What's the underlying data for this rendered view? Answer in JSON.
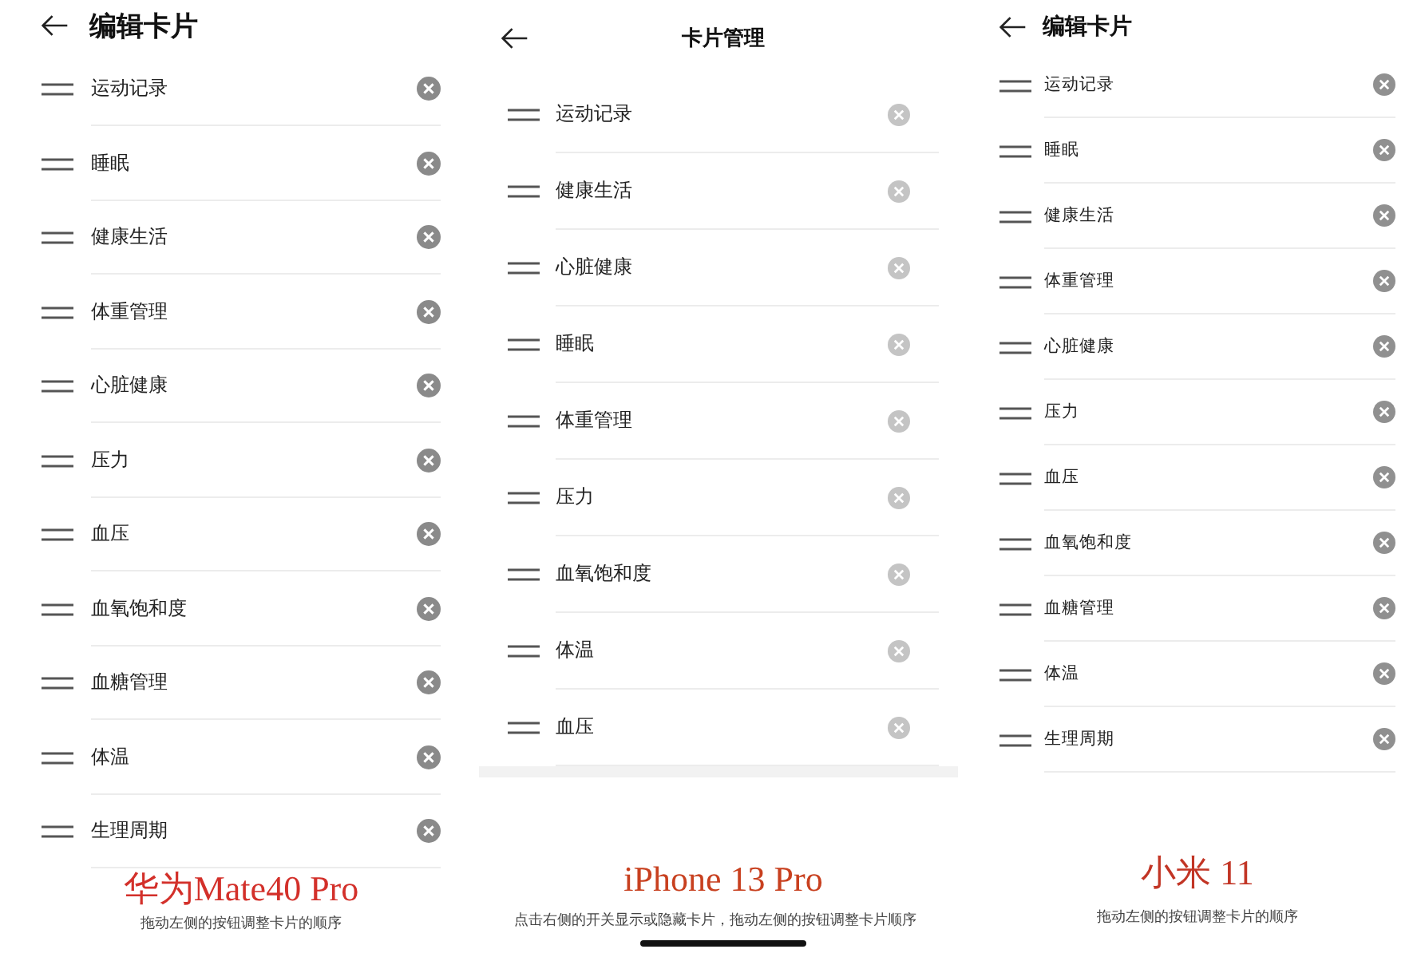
{
  "panels": [
    {
      "kind": "android",
      "title": "编辑卡片",
      "items": [
        {
          "label": "运动记录"
        },
        {
          "label": "睡眠"
        },
        {
          "label": "健康生活"
        },
        {
          "label": "体重管理"
        },
        {
          "label": "心脏健康"
        },
        {
          "label": "压力"
        },
        {
          "label": "血压"
        },
        {
          "label": "血氧饱和度"
        },
        {
          "label": "血糖管理"
        },
        {
          "label": "体温"
        },
        {
          "label": "生理周期"
        }
      ],
      "caption": "华为Mate40 Pro",
      "hint": "拖动左侧的按钮调整卡片的顺序"
    },
    {
      "kind": "ios",
      "title": "卡片管理",
      "items": [
        {
          "label": "运动记录"
        },
        {
          "label": "健康生活"
        },
        {
          "label": "心脏健康"
        },
        {
          "label": "睡眠"
        },
        {
          "label": "体重管理"
        },
        {
          "label": "压力"
        },
        {
          "label": "血氧饱和度"
        },
        {
          "label": "体温"
        },
        {
          "label": "血压"
        }
      ],
      "caption": "iPhone 13 Pro",
      "hint": "点击右侧的开关显示或隐藏卡片，拖动左侧的按钮调整卡片顺序"
    },
    {
      "kind": "miui",
      "title": "编辑卡片",
      "items": [
        {
          "label": "运动记录"
        },
        {
          "label": "睡眠"
        },
        {
          "label": "健康生活"
        },
        {
          "label": "体重管理"
        },
        {
          "label": "心脏健康"
        },
        {
          "label": "压力"
        },
        {
          "label": "血压"
        },
        {
          "label": "血氧饱和度"
        },
        {
          "label": "血糖管理"
        },
        {
          "label": "体温"
        },
        {
          "label": "生理周期"
        }
      ],
      "caption": "小米 11",
      "hint": "拖动左侧的按钮调整卡片的顺序"
    }
  ]
}
